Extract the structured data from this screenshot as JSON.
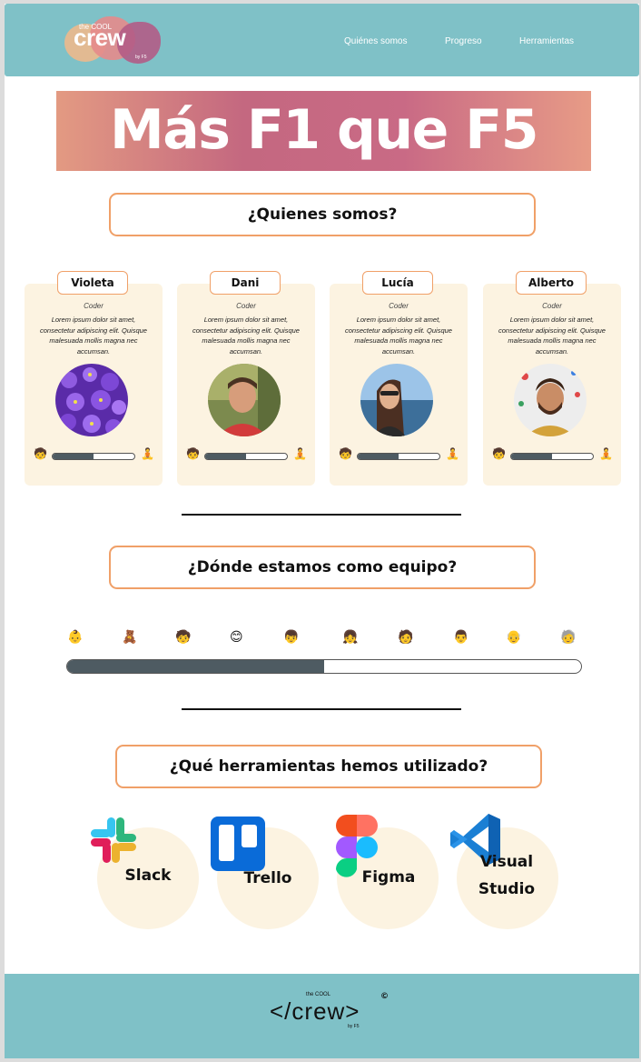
{
  "header": {
    "logo_small": "the COOL",
    "logo_big": "crew",
    "logo_by": "by F5",
    "nav": [
      {
        "label": "Quiénes somos"
      },
      {
        "label": "Progreso"
      },
      {
        "label": "Herramientas"
      }
    ]
  },
  "hero": {
    "title": "Más F1 que F5"
  },
  "team_section": {
    "title": "¿Quienes somos?"
  },
  "members": [
    {
      "name": "Violeta",
      "role": "Coder",
      "description": "Lorem ipsum dolor sit amet, consectetur adipiscing elit. Quisque malesuada mollis magna nec accumsan.",
      "progress": 0.5,
      "avatar_icon": "flowers-photo"
    },
    {
      "name": "Dani",
      "role": "Coder",
      "description": "Lorem ipsum dolor sit amet, consectetur adipiscing elit. Quisque malesuada mollis magna nec accumsan.",
      "progress": 0.5,
      "avatar_icon": "man-photo"
    },
    {
      "name": "Lucía",
      "role": "Coder",
      "description": "Lorem ipsum dolor sit amet, consectetur adipiscing elit. Quisque malesuada mollis magna nec accumsan.",
      "progress": 0.5,
      "avatar_icon": "woman-photo"
    },
    {
      "name": "Alberto",
      "role": "Coder",
      "description": "Lorem ipsum dolor sit amet, consectetur adipiscing elit. Quisque malesuada mollis magna nec accumsan.",
      "progress": 0.5,
      "avatar_icon": "bearded-man-photo"
    }
  ],
  "progress_section": {
    "title": "¿Dónde estamos como equipo?",
    "milestone_icons": [
      "baby-icon",
      "crawling-baby-icon",
      "child-icon",
      "kid-icon",
      "boy-icon",
      "girl-icon",
      "teen-icon",
      "adult-icon",
      "old-man-icon",
      "elder-icon"
    ],
    "progress": 0.5
  },
  "tools_section": {
    "title": "¿Qué herramientas hemos utilizado?",
    "tools": [
      {
        "name": "Slack",
        "icon": "slack-icon"
      },
      {
        "name": "Trello",
        "icon": "trello-icon"
      },
      {
        "name": "Figma",
        "icon": "figma-icon"
      },
      {
        "name": "Visual Studio",
        "icon": "vscode-icon"
      }
    ]
  },
  "footer": {
    "logo_text": "</crew>",
    "logo_small": "the COOL",
    "logo_by": "by F5",
    "copyright": "©"
  },
  "colors": {
    "header_bg": "#7fc1c7",
    "accent_border": "#f0a068",
    "card_bg": "#fcf3e1",
    "bar_fill": "#4e5b62"
  }
}
